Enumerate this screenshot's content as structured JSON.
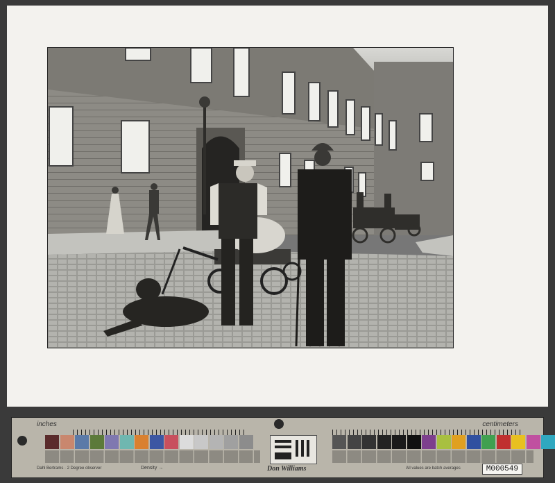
{
  "photo": {
    "subject": "historic street scene",
    "tone": "sepia-monochrome"
  },
  "color_checker": {
    "left_label": "inches",
    "right_label": "centimeters",
    "density_label": "Density →",
    "maker_label": "Don Williams",
    "note_left": "Dahl Bertrams · 2 Degree observer",
    "note_right": "All values are batch averages",
    "patch_colors_left": [
      "#5a2b2b",
      "#c9876e",
      "#5b7aa8",
      "#5c7a3a",
      "#7f78b0",
      "#6fb7b0",
      "#d98030",
      "#3d57a3",
      "#c8505e",
      "#dcdcdc",
      "#c8c8c8",
      "#b4b4b4",
      "#a0a0a0",
      "#8c8c8c"
    ],
    "patch_colors_right": [
      "#555555",
      "#444444",
      "#333333",
      "#222222",
      "#1a1a1a",
      "#111111",
      "#7d3f8d",
      "#a8c040",
      "#e0a020",
      "#3050a0",
      "#40a050",
      "#c03030",
      "#e8c020",
      "#c050a0",
      "#30a8c0"
    ]
  },
  "catalog_id": "M000549"
}
